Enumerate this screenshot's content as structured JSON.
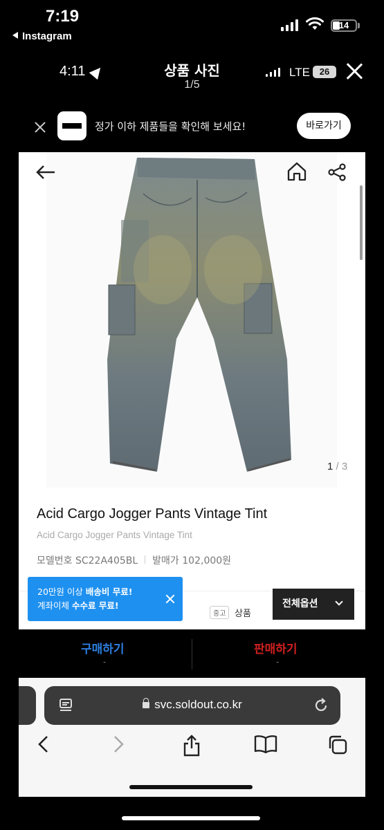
{
  "outer_status": {
    "time": "7:19",
    "back_app": "Instagram",
    "battery": "14"
  },
  "header": {
    "inner_time": "4:11",
    "title": "상품 사진",
    "count": "1/5",
    "network": "LTE",
    "battery": "26"
  },
  "banner": {
    "text": "정가 이하 제품들을 확인해 보세요!",
    "button": "바로가기"
  },
  "product": {
    "image_counter_current": "1",
    "image_counter_total": "/ 3",
    "title": "Acid Cargo Jogger Pants Vintage Tint",
    "subtitle": "Acid Cargo Jogger Pants Vintage Tint",
    "model_label": "모델번호",
    "model_value": "SC22A405BL",
    "price_label": "발매가",
    "price_value": "102,000원"
  },
  "tooltip": {
    "line1_prefix": "20만원 이상 ",
    "line1_bold": "배송비 무료!",
    "line2_prefix": "계좌이체 ",
    "line2_bold": "수수료 무료!"
  },
  "options": {
    "condition_badge": "중고",
    "condition_label": "상품",
    "button": "전체옵션"
  },
  "actions": {
    "buy": "구매하기",
    "buy_price": "-",
    "sell": "판매하기",
    "sell_price": "-"
  },
  "safari": {
    "url": "svc.soldout.co.kr"
  },
  "colors": {
    "buy": "#2d7fe0",
    "sell": "#d02020",
    "tooltip": "#1e90f0"
  }
}
